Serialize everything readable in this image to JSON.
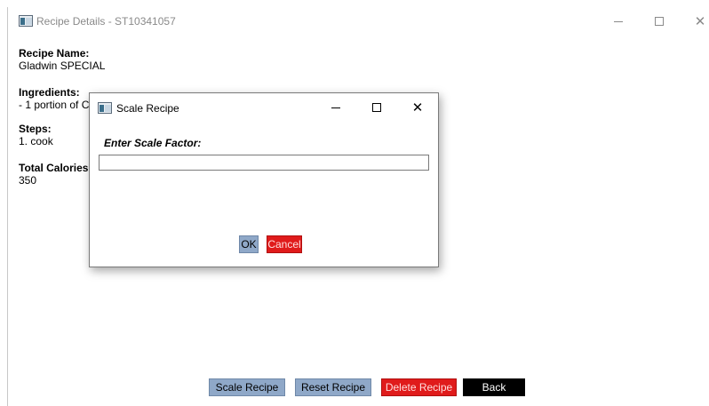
{
  "main_window": {
    "title": "Recipe Details - ST10341057",
    "recipe_name_label": "Recipe Name:",
    "recipe_name_value": "Gladwin SPECIAL",
    "ingredients_label": "Ingredients:",
    "ingredients_value": "- 1 portion of C",
    "steps_label": "Steps:",
    "steps_value": "1. cook",
    "calories_label": "Total Calories:",
    "calories_value": "350",
    "buttons": {
      "scale": "Scale Recipe",
      "reset": "Reset Recipe",
      "delete": "Delete Recipe",
      "back": "Back"
    }
  },
  "dialog": {
    "title": "Scale Recipe",
    "prompt": "Enter Scale Factor:",
    "input_value": "",
    "ok_label": "OK",
    "cancel_label": "Cancel"
  },
  "window_controls": {
    "minimize_icon": "minimize-icon",
    "maximize_icon": "maximize-icon",
    "close_icon": "close-icon",
    "close_glyph": "✕"
  },
  "colors": {
    "blue_button": "#8fa8c8",
    "red_button": "#e01b1b",
    "black_button": "#000000"
  }
}
